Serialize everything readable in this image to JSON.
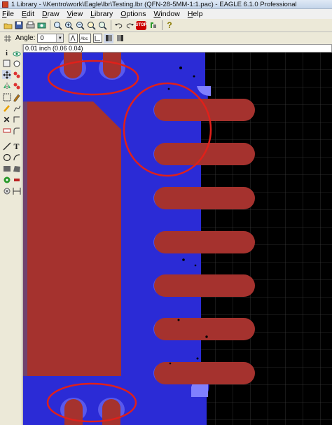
{
  "window": {
    "title": "1 Library - \\\\Kentro\\work\\Eagle\\lbr\\Testing.lbr (QFN-28-5MM-1:1.pac) - EAGLE 6.1.0 Professional"
  },
  "menu": {
    "items": [
      "File",
      "Edit",
      "Draw",
      "View",
      "Library",
      "Options",
      "Window",
      "Help"
    ]
  },
  "toolbar": {
    "stop_label": "STOP",
    "angle_label": "Angle:",
    "angle_value": "0",
    "text_tool_label": "Abc"
  },
  "status": {
    "coordinate_readout": "0.01 inch (0.06 0.04)"
  },
  "colors": {
    "board_blue": "#2b2bd6",
    "pad_red": "#a5322e",
    "highlight_circle": "#e0201a",
    "grid": "#3a3a3a",
    "background": "#000000"
  },
  "icons": {
    "toolbar": [
      "open-icon",
      "save-icon",
      "print-icon",
      "cam-icon",
      "zoom-fit-icon",
      "zoom-in-icon",
      "zoom-out-icon",
      "zoom-redraw-icon",
      "zoom-area-icon",
      "undo-icon",
      "redo-icon",
      "stop-icon",
      "go-icon",
      "help-icon"
    ],
    "palette": [
      "info-icon",
      "show-icon",
      "move-icon",
      "copy-icon",
      "mirror-icon",
      "rotate-icon",
      "group-icon",
      "change-icon",
      "paste-icon",
      "delete-icon",
      "split-icon",
      "name-icon",
      "value-icon",
      "miter-icon",
      "wire-icon",
      "text-icon",
      "circle-icon",
      "arc-icon",
      "rect-icon",
      "polygon-icon",
      "via-icon",
      "smd-icon",
      "hole-icon",
      "dimension-icon"
    ]
  }
}
